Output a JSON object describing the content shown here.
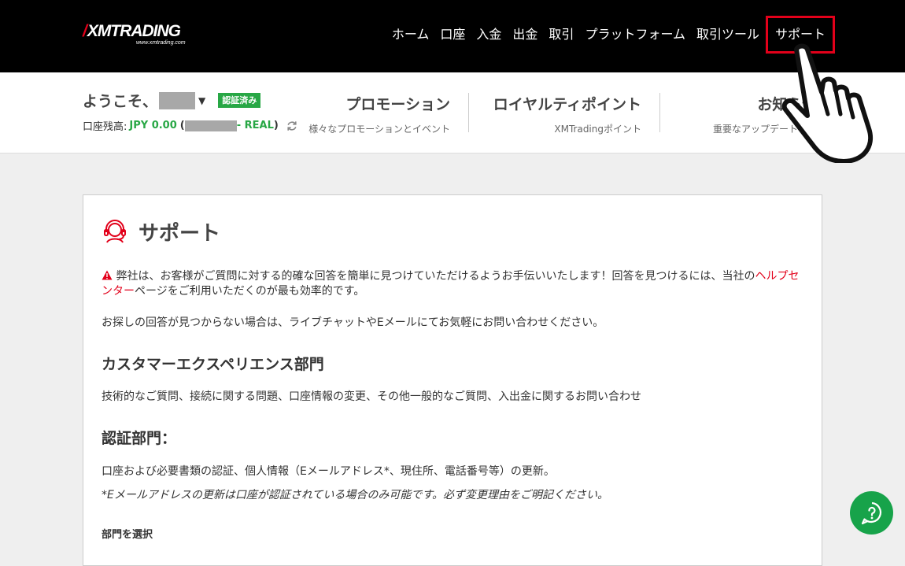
{
  "logo": {
    "brand": "XMTRADING",
    "domain": "www.xmtrading.com"
  },
  "nav": {
    "items": [
      "ホーム",
      "口座",
      "入金",
      "出金",
      "取引",
      "プラットフォーム",
      "取引ツール"
    ],
    "active": "サポート"
  },
  "account": {
    "welcome": "ようこそ、",
    "verified": "認証済み",
    "balance_label": "口座残高:",
    "balance_value": "JPY 0.00",
    "open_paren": "(",
    "account_type": "- REAL",
    "close_paren": ")"
  },
  "promos": [
    {
      "title": "プロモーション",
      "sub": "様々なプロモーションとイベント"
    },
    {
      "title": "ロイヤルティポイント",
      "sub": "XMTradingポイント"
    },
    {
      "title": "お知らせ",
      "sub": "重要なアップデート＆リ"
    }
  ],
  "support": {
    "title": "サポート",
    "intro": "弊社は、お客様がご質問に対する的確な回答を簡単に見つけていただけるようお手伝いいたします！回答を見つけるには、当社の",
    "help_link": "ヘルプセンター",
    "intro_end": "ページをご利用いただくのが最も効率的です。",
    "contact": "お探しの回答が見つからない場合は、ライブチャットやEメールにてお気軽にお問い合わせください。",
    "cx_title": "カスタマーエクスペリエンス部門",
    "cx_desc": "技術的なご質問、接続に関する問題、口座情報の変更、その他一般的なご質問、入出金に関するお問い合わせ",
    "verify_title": "認証部門：",
    "verify_desc": "口座および必要書類の認証、個人情報（Eメールアドレス*、現住所、電話番号等）の更新。",
    "verify_note": "*Eメールアドレスの更新は口座が認証されている場合のみ可能です。必ず変更理由をご明記ください。",
    "select_dept": "部門を選択"
  },
  "colors": {
    "brand_red": "#e2001a",
    "success_green": "#28a745",
    "help_green": "#17a34a"
  },
  "icons": {
    "support": "headset-icon",
    "warning": "warning-icon",
    "refresh": "refresh-icon",
    "help": "help-icon",
    "cursor": "hand-pointer-icon"
  }
}
